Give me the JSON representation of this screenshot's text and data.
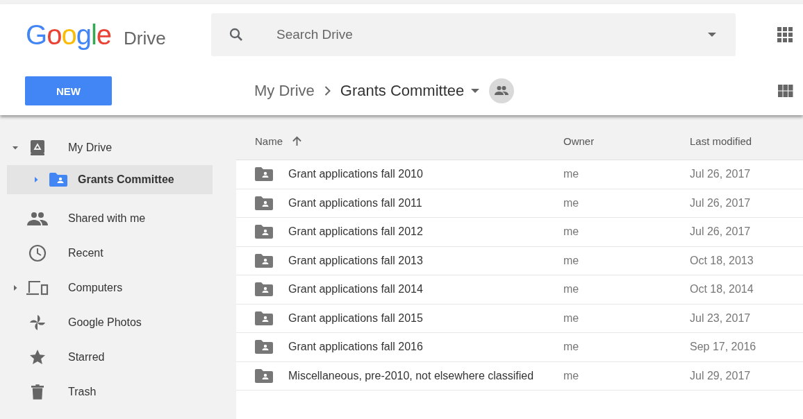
{
  "logo": {
    "brand": "Google",
    "product": "Drive"
  },
  "search": {
    "placeholder": "Search Drive"
  },
  "new_button": "NEW",
  "breadcrumb": [
    {
      "label": "My Drive",
      "current": false
    },
    {
      "label": "Grants Committee",
      "current": true
    }
  ],
  "sidebar": {
    "items": [
      {
        "label": "My Drive",
        "kind": "drive",
        "expanded": true,
        "selected": false,
        "children": [
          {
            "label": "Grants Committee",
            "kind": "folder",
            "expanded": false,
            "selected": true
          }
        ]
      },
      {
        "label": "Shared with me",
        "kind": "shared",
        "selected": false
      },
      {
        "label": "Recent",
        "kind": "recent",
        "selected": false
      },
      {
        "label": "Computers",
        "kind": "computers",
        "expanded": false,
        "selected": false
      },
      {
        "label": "Google Photos",
        "kind": "photos",
        "selected": false
      },
      {
        "label": "Starred",
        "kind": "starred",
        "selected": false
      },
      {
        "label": "Trash",
        "kind": "trash",
        "selected": false
      }
    ]
  },
  "table": {
    "columns": [
      {
        "label": "Name",
        "sorted": true
      },
      {
        "label": "Owner",
        "sorted": false
      },
      {
        "label": "Last modified",
        "sorted": false
      }
    ],
    "rows": [
      {
        "name": "Grant applications fall 2010",
        "owner": "me",
        "modified": "Jul 26, 2017"
      },
      {
        "name": "Grant applications fall 2011",
        "owner": "me",
        "modified": "Jul 26, 2017"
      },
      {
        "name": "Grant applications fall 2012",
        "owner": "me",
        "modified": "Jul 26, 2017"
      },
      {
        "name": "Grant applications fall 2013",
        "owner": "me",
        "modified": "Oct 18, 2013"
      },
      {
        "name": "Grant applications fall 2014",
        "owner": "me",
        "modified": "Oct 18, 2014"
      },
      {
        "name": "Grant applications fall 2015",
        "owner": "me",
        "modified": "Jul 23, 2017"
      },
      {
        "name": "Grant applications fall 2016",
        "owner": "me",
        "modified": "Sep 17, 2016"
      },
      {
        "name": "Miscellaneous, pre-2010, not elsewhere classified",
        "owner": "me",
        "modified": "Jul 29, 2017"
      }
    ]
  }
}
